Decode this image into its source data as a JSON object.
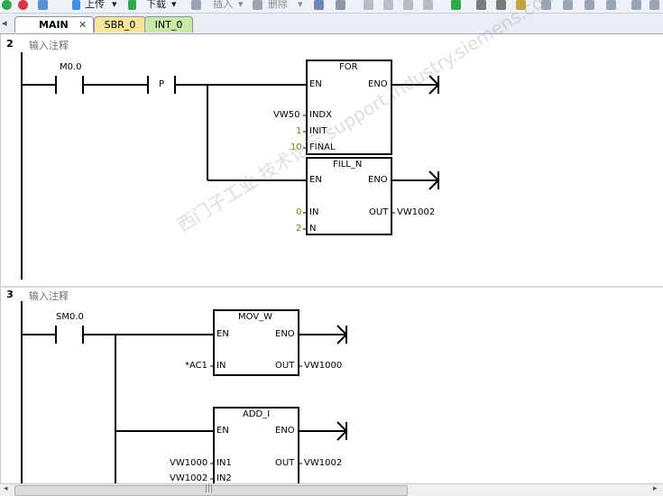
{
  "toolbar": {
    "upload_label": "上传",
    "download_label": "下载",
    "insert_label": "插入",
    "delete_label": "删除"
  },
  "tabs": [
    {
      "label": "MAIN",
      "active": true,
      "color": "#ffffff"
    },
    {
      "label": "SBR_0",
      "active": false,
      "color": "#f7e59a"
    },
    {
      "label": "INT_0",
      "active": false,
      "color": "#c9e9a8"
    }
  ],
  "network2": {
    "number": "2",
    "comment": "输入注释",
    "contact": "M0.0",
    "p_label": "P",
    "for_box": {
      "title": "FOR",
      "en": "EN",
      "eno": "ENO",
      "indx": "INDX",
      "init": "INIT",
      "final": "FINAL",
      "indx_val": "VW50",
      "init_val": "1",
      "final_val": "10"
    },
    "fill_box": {
      "title": "FILL_N",
      "en": "EN",
      "eno": "ENO",
      "in": "IN",
      "n": "N",
      "out": "OUT",
      "in_val": "0",
      "n_val": "2",
      "out_val": "VW1002"
    }
  },
  "network3": {
    "number": "3",
    "comment": "输入注释",
    "contact": "SM0.0",
    "mov_box": {
      "title": "MOV_W",
      "en": "EN",
      "eno": "ENO",
      "in": "IN",
      "out": "OUT",
      "in_val": "*AC1",
      "out_val": "VW1000"
    },
    "add_box": {
      "title": "ADD_I",
      "en": "EN",
      "eno": "ENO",
      "in1": "IN1",
      "in2": "IN2",
      "out": "OUT",
      "in1_val": "VW1000",
      "in2_val": "VW1002",
      "out_val": "VW1002"
    }
  },
  "watermark": "西门子工业 技术论坛 support.industry.siemens.com/cs",
  "scrollbar": {
    "thumb_glyph": "|||"
  }
}
